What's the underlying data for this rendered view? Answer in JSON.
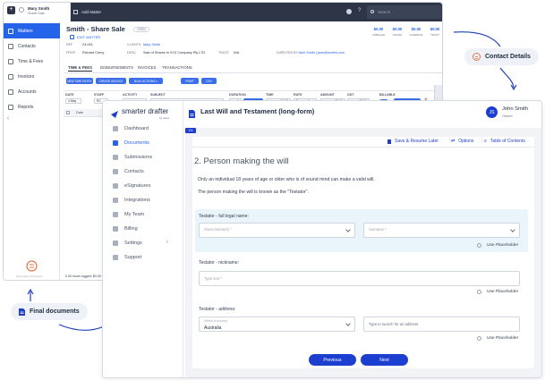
{
  "back_app": {
    "user": {
      "name": "Mary Smith",
      "subtitle": "Share Sale"
    },
    "add_matter": "Add Matter",
    "search_placeholder": "Search",
    "nav": [
      {
        "label": "Matters",
        "icon": "matters-icon"
      },
      {
        "label": "Contacts",
        "icon": "contacts-icon"
      },
      {
        "label": "Time & Fees",
        "icon": "clock-icon"
      },
      {
        "label": "Invoices",
        "icon": "invoice-icon"
      },
      {
        "label": "Accounts",
        "icon": "accounts-icon"
      },
      {
        "label": "Reports",
        "icon": "reports-icon"
      }
    ],
    "footer_text": "New brand • PC sound •",
    "matter": {
      "title": "Smith - Share Sale",
      "badge": "OPEN",
      "edit": "EDIT MATTER",
      "ref_label": "REF",
      "ref": "23-001",
      "client_label": "CLIENTS",
      "client": "Mary Smith",
      "prop_label": "PROP",
      "prop": "Richard Cerny",
      "desc_label": "DESC",
      "desc": "Sale of Shares in XYZ Company Pty LTD",
      "trust_label": "TRUST",
      "trust": "N/A",
      "disputed_label": "DISPUTED BY",
      "disputed": "Jane Smith | jane@smiths.com"
    },
    "money": [
      {
        "value": "$0.00",
        "label": "UNBILLED"
      },
      {
        "value": "$0.00",
        "label": "OWING"
      },
      {
        "value": "$0.00",
        "label": "OVERDUE"
      },
      {
        "value": "$0.00",
        "label": "TRUST"
      }
    ],
    "tabs": [
      "TIME & FEES",
      "DISBURSEMENTS",
      "INVOICES",
      "TRANSACTIONS"
    ],
    "actions": [
      "NEW TIME ENTRY",
      "CREATE INVOICE",
      "BULK ACTIONS ▾",
      "PRINT",
      "CSV"
    ],
    "columns": [
      "DATE",
      "STAFF",
      "ACTIVITY",
      "SUBJECT",
      "DURATION",
      "TIME",
      "RATE",
      "AMOUNT",
      "GST",
      "BILLABLE"
    ],
    "row": {
      "date": "4 May",
      "staff": "RC",
      "duration": "1",
      "unit": "HR",
      "time": "01:00",
      "rate": "$",
      "amount": "0",
      "amt2": "$0.00",
      "gst": "$0.00",
      "add": "ADD"
    },
    "date_header": "Date",
    "logged": "0.00 hours logged: $0.00"
  },
  "callouts": {
    "contact_details": "Contact Details",
    "final_documents": "Final documents"
  },
  "front_app": {
    "logo": "smarter drafter",
    "logo_sub": "by Janet",
    "nav": [
      {
        "label": "Dashboard",
        "icon": "dashboard-icon"
      },
      {
        "label": "Documents",
        "icon": "documents-icon"
      },
      {
        "label": "Submissions",
        "icon": "submissions-icon"
      },
      {
        "label": "Contacts",
        "icon": "contacts-icon"
      },
      {
        "label": "eSignatures",
        "icon": "esignature-icon"
      },
      {
        "label": "Integrations",
        "icon": "integrations-icon"
      },
      {
        "label": "My Team",
        "icon": "team-icon"
      },
      {
        "label": "Billing",
        "icon": "billing-icon"
      },
      {
        "label": "Settings",
        "icon": "settings-icon"
      },
      {
        "label": "Support",
        "icon": "support-icon"
      }
    ],
    "doc_title": "Last Will and Testament (long-form)",
    "user_initials": "JS",
    "user_name": "John Smith",
    "user_role": "Owner",
    "progress_tag": "1%",
    "save_resume": "Save & Resume Later",
    "options": "Options",
    "toc": "Table of Contents",
    "section_title": "2. Person making the will",
    "paragraph1": "Only an individual 18 years of age or older who is of sound mind can make a valid will.",
    "paragraph2": "The person making the will is known as the \"Testator\".",
    "full_legal_label": "Testator - full legal name:",
    "given_placeholder": "Given Name(s) *",
    "surname_placeholder": "Surname *",
    "use_placeholder": "Use Placeholder",
    "nickname_label": "Testator - nickname:",
    "nickname_placeholder": "Type text *",
    "address_label": "Testator - address:",
    "country_placeholder": "Select a country",
    "country_value": "Australia",
    "address_search_placeholder": "Type to search for an address",
    "prev": "Previous",
    "next": "Next"
  }
}
